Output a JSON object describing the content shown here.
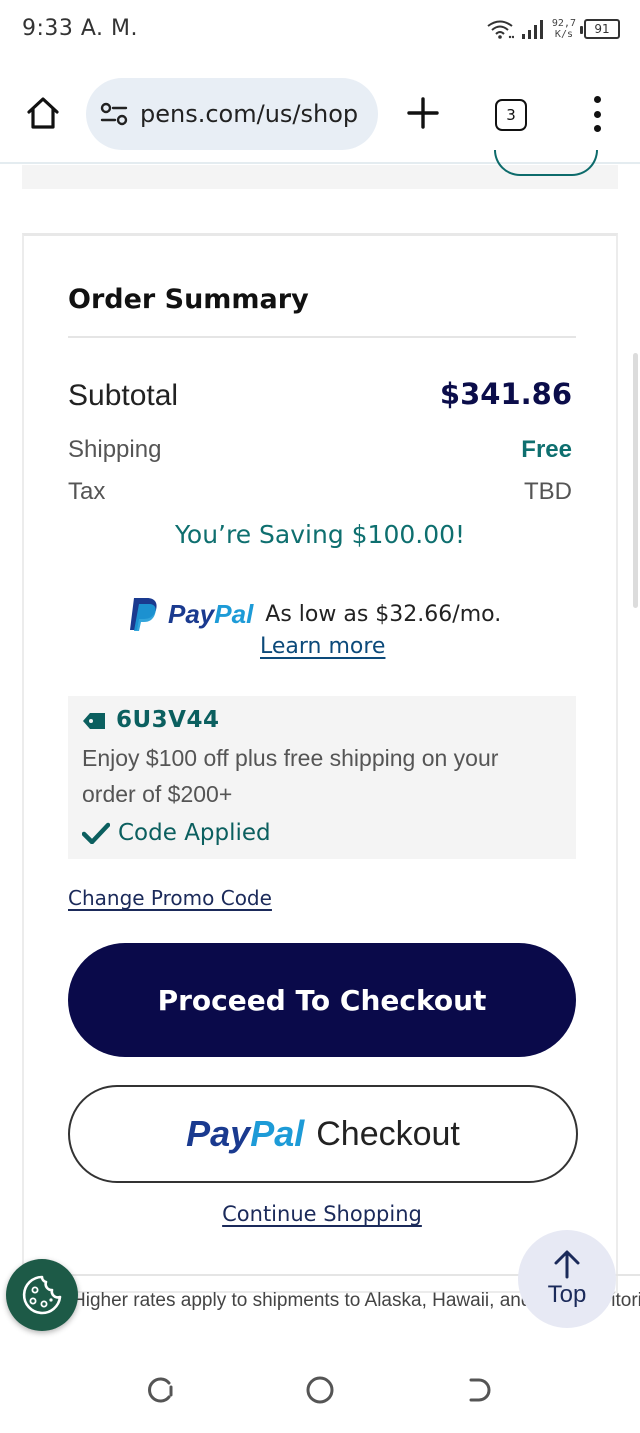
{
  "status_bar": {
    "time": "9:33 A. M.",
    "net_speed_value": "92,7",
    "net_speed_unit": "K/s",
    "battery": "91"
  },
  "browser": {
    "url": "pens.com/us/shop",
    "tab_count": "3",
    "icons": [
      "home-icon",
      "site-settings-icon",
      "plus-icon",
      "menu-dots-icon"
    ]
  },
  "order_summary": {
    "title": "Order Summary",
    "subtotal_label": "Subtotal",
    "subtotal_value": "$341.86",
    "shipping_label": "Shipping",
    "shipping_value": "Free",
    "tax_label": "Tax",
    "tax_value": "TBD",
    "saving_text": "You’re Saving $100.00!"
  },
  "paypal_offer": {
    "brand_pay": "Pay",
    "brand_pal": "Pal",
    "offer": "As low as $32.66/mo.",
    "learn_more": "Learn more"
  },
  "promo": {
    "code": "6U3V44",
    "description": "Enjoy $100 off plus free shipping on your order of $200+",
    "status": "Code Applied",
    "change_link": "Change Promo Code"
  },
  "actions": {
    "checkout_label": "Proceed To Checkout",
    "paypal_pay": "Pay",
    "paypal_pal": "Pal",
    "paypal_checkout_label": "Checkout",
    "continue_shopping": "Continue Shopping"
  },
  "footer": {
    "note": "Higher rates apply to shipments to Alaska, Hawaii, and U.S. Territories",
    "top_label": "Top"
  },
  "colors": {
    "navy": "#0a0a4a",
    "teal": "#0e6f6f",
    "paypal_dark": "#1a3a8f",
    "paypal_light": "#1d9bd7",
    "cookie_green": "#1d5a47"
  }
}
